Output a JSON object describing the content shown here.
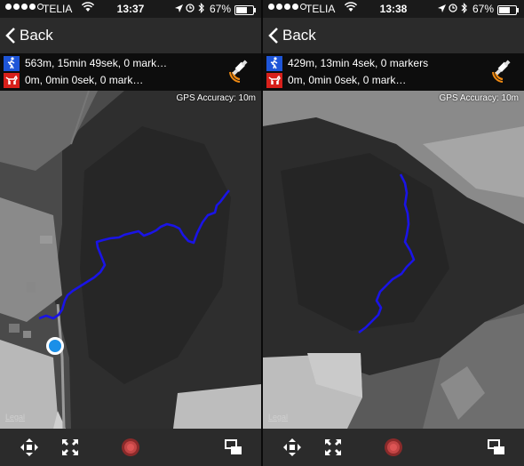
{
  "screens": [
    {
      "status": {
        "carrier": "TELIA",
        "time": "13:37",
        "battery": "67%",
        "battery_level": 0.67
      },
      "nav": {
        "back_label": "Back"
      },
      "tracks": {
        "person": "563m, 15min 49sek, 0 mark…",
        "dog": "0m, 0min 0sek, 0 mark…"
      },
      "map": {
        "accuracy": "GPS Accuracy: 10m",
        "legal": "Legal"
      }
    },
    {
      "status": {
        "carrier": "TELIA",
        "time": "13:38",
        "battery": "67%",
        "battery_level": 0.67
      },
      "nav": {
        "back_label": "Back"
      },
      "tracks": {
        "person": "429m, 13min 4sek, 0 markers",
        "dog": "0m, 0min 0sek, 0 mark…"
      },
      "map": {
        "accuracy": "GPS Accuracy: 10m",
        "legal": "Legal"
      }
    }
  ],
  "colors": {
    "track": "#1a14e6",
    "person_badge": "#1e55d8",
    "dog_badge": "#d8201b",
    "gps_icon": "#f08a12"
  },
  "toolbar_icons": [
    "move-icon",
    "fullscreen-icon",
    "record-icon",
    "layers-icon"
  ]
}
